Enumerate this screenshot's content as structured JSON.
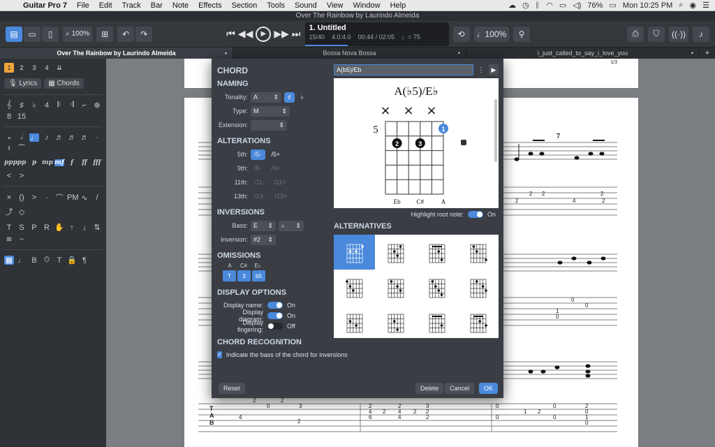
{
  "menubar": {
    "app_name": "Guitar Pro 7",
    "items": [
      "File",
      "Edit",
      "Track",
      "Bar",
      "Note",
      "Effects",
      "Section",
      "Tools",
      "Sound",
      "View",
      "Window",
      "Help"
    ],
    "battery": "76%",
    "clock": "Mon 10:25 PM"
  },
  "window": {
    "title": "Over The Rainbow by Laurindo Almeida"
  },
  "toolbar": {
    "zoom": "100%",
    "song_number_title": "1. Untitled",
    "bar_position": "15/40",
    "time_signature": "4.0:4.0",
    "time": "00:44 / 02:05",
    "tempo": "= 75",
    "volume": "100%"
  },
  "tabs": [
    {
      "label": "Over The Rainbow by Laurindo Almeida",
      "active": true
    },
    {
      "label": "Bossa Nova Bossa",
      "active": false
    },
    {
      "label": "i_just_called_to_say_i_love_you",
      "active": false
    }
  ],
  "palette": {
    "voices": [
      "1",
      "2",
      "3",
      "4"
    ],
    "lyrics_label": "Lyrics",
    "chords_label": "Chords",
    "dynamics": [
      "ppp",
      "pp",
      "p",
      "mp",
      "mf",
      "f",
      "ff",
      "fff"
    ]
  },
  "score": {
    "page_number": "1/3",
    "bar_number": "7"
  },
  "dialog": {
    "title": "CHORD",
    "naming": {
      "heading": "NAMING",
      "tonality_label": "Tonality:",
      "tonality_value": "A",
      "sharp": "♯",
      "flat": "♭",
      "type_label": "Type:",
      "type_value": "M",
      "extension_label": "Extension:",
      "extension_value": ""
    },
    "alterations": {
      "heading": "ALTERATIONS",
      "rows": [
        {
          "label": "5th:",
          "minus": "/5-",
          "plus": "/5+",
          "active": true
        },
        {
          "label": "9th:",
          "minus": "/9-",
          "plus": "/9+",
          "active": false
        },
        {
          "label": "11th:",
          "minus": "/11-",
          "plus": "/11+",
          "active": false
        },
        {
          "label": "13th:",
          "minus": "/13-",
          "plus": "/13+",
          "active": false
        }
      ]
    },
    "inversions": {
      "heading": "INVERSIONS",
      "bass_label": "Bass:",
      "bass_value": "E",
      "bass_accidental": "♭",
      "inversion_label": "Inversion:",
      "inversion_value": "#2"
    },
    "omissions": {
      "heading": "OMISSIONS",
      "labels": [
        "A",
        "C#",
        "E♭"
      ],
      "buttons": [
        "T",
        "3",
        "b5"
      ]
    },
    "display": {
      "heading": "DISPLAY OPTIONS",
      "name_label": "Display name:",
      "name_state": "On",
      "diagram_label": "Display diagram:",
      "diagram_state": "On",
      "fingering_label": "Display fingering:",
      "fingering_state": "Off"
    },
    "recognition": {
      "heading": "CHORD RECOGNITION",
      "checkbox_label": "Indicate the bass of the chord for inversions"
    },
    "chord_name_input": "A(b5)/Eb",
    "diagram": {
      "name": "A(♭5)/E♭",
      "fret": "5",
      "muted": [
        "×",
        "×",
        "×"
      ],
      "fingers": [
        "1",
        "2",
        "3"
      ],
      "notes": [
        "Eb",
        "C#",
        "A"
      ]
    },
    "highlight_label": "Highlight root note:",
    "highlight_state": "On",
    "alternatives_heading": "ALTERNATIVES",
    "buttons": {
      "reset": "Reset",
      "delete": "Delete",
      "cancel": "Cancel",
      "ok": "OK"
    }
  },
  "colors": {
    "accent": "#4a89dc",
    "panel": "#3a3e44",
    "toolbar": "#34373c"
  }
}
